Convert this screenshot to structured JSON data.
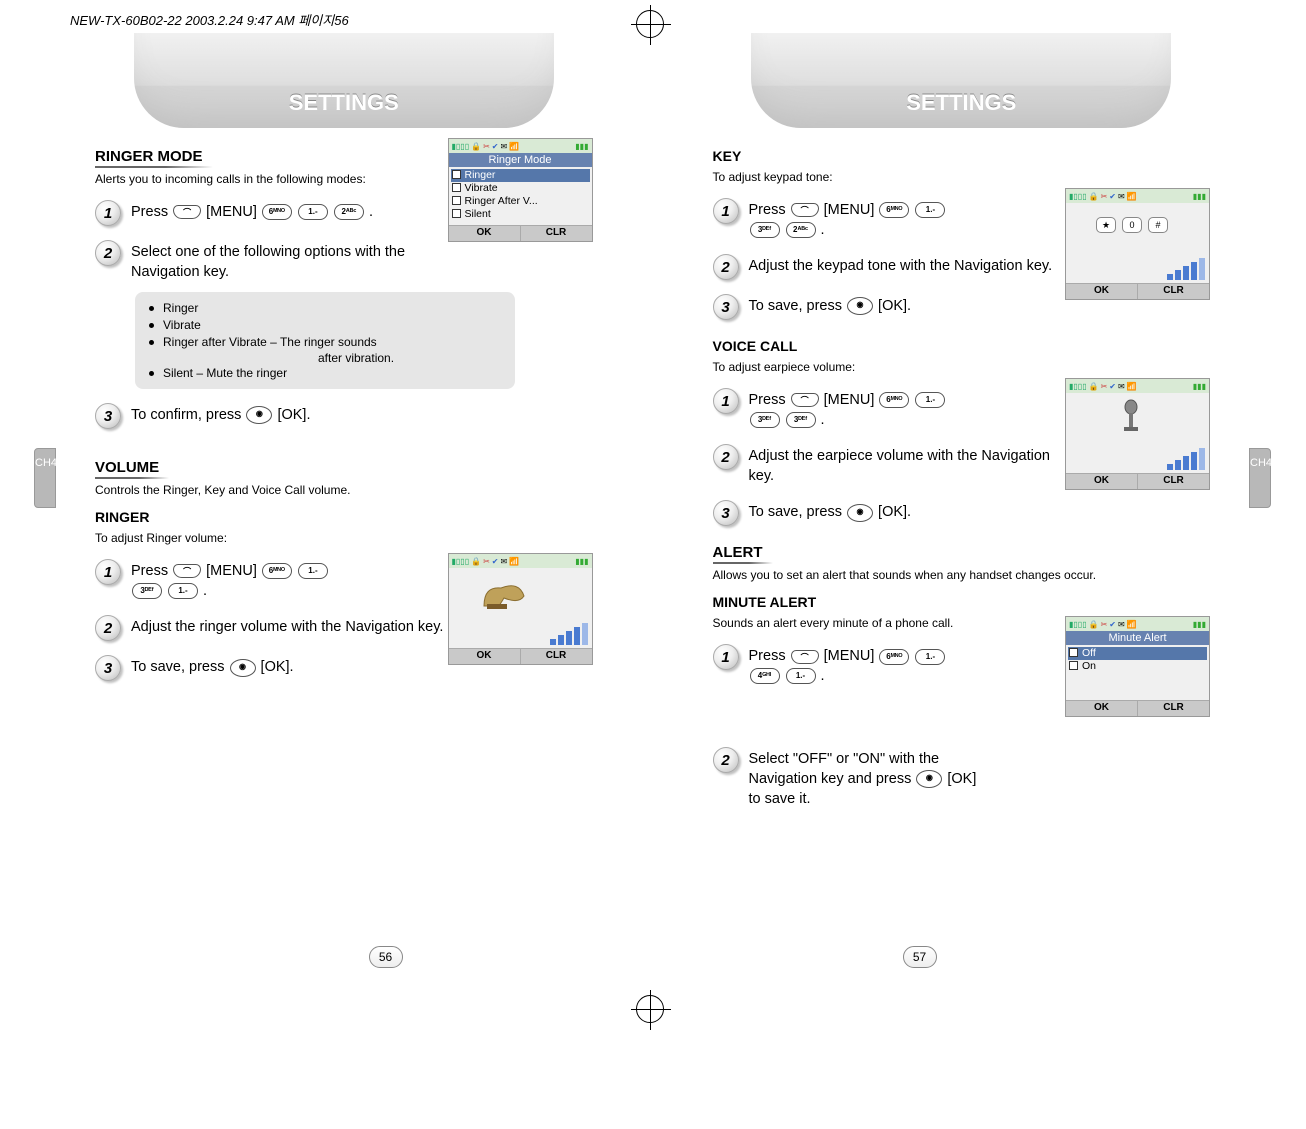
{
  "meta_header": "NEW-TX-60B02-22  2003.2.24 9:47 AM  페이지56",
  "left": {
    "banner": "SETTINGS",
    "side_tab": "CH4",
    "page_number": "56",
    "ringer_mode": {
      "heading": "RINGER MODE",
      "sub": "Alerts you to incoming calls in the following modes:",
      "step1": "Press          [MENU]                         .",
      "step1_menu": "[MENU]",
      "step2": "Select one of the following options with the Navigation key.",
      "options": {
        "a": "Ringer",
        "b": "Vibrate",
        "c": "Ringer after Vibrate – The ringer sounds",
        "c2": "after vibration.",
        "d": "Silent – Mute the ringer"
      },
      "step3": "To confirm, press           [OK].",
      "screen": {
        "title": "Ringer Mode",
        "opt1": "Ringer",
        "opt2": "Vibrate",
        "opt3": "Ringer After V...",
        "opt4": "Silent",
        "ok": "OK",
        "clr": "CLR"
      }
    },
    "volume": {
      "heading": "VOLUME",
      "sub": "Controls the Ringer, Key and Voice Call volume."
    },
    "ringer": {
      "heading": "RINGER",
      "sub": "To adjust Ringer volume:",
      "step1": "Press           [MENU]                   \n                         .",
      "step2": "Adjust the ringer volume with the Navigation key.",
      "step3": "To save, press           [OK].",
      "screen": {
        "ok": "OK",
        "clr": "CLR"
      }
    }
  },
  "right": {
    "banner": "SETTINGS",
    "side_tab": "CH4",
    "page_number": "57",
    "key": {
      "heading": "KEY",
      "sub": "To adjust keypad tone:",
      "step1": "Press           [MENU]                   \n                         .",
      "step2": "Adjust the keypad tone with the Navigation key.",
      "step3": "To save, press           [OK].",
      "screen": {
        "ok": "OK",
        "clr": "CLR"
      }
    },
    "voice": {
      "heading": "VOICE CALL",
      "sub": "To adjust earpiece volume:",
      "step1": "Press           [MENU]                   \n                         .",
      "step2": "Adjust the earpiece volume with the Navigation key.",
      "step3": "To save, press           [OK].",
      "screen": {
        "ok": "OK",
        "clr": "CLR"
      }
    },
    "alert": {
      "heading": "ALERT",
      "sub": "Allows you to set an alert that sounds when any handset changes occur."
    },
    "minute": {
      "heading": "MINUTE ALERT",
      "sub": "Sounds an alert every minute of a phone call.",
      "step1": "Press           [MENU]                   \n                     .",
      "step2": "Select \"OFF\" or \"ON\" with the Navigation key and press         [OK] to save it.",
      "screen": {
        "title": "Minute Alert",
        "opt1": "Off",
        "opt2": "On",
        "ok": "OK",
        "clr": "CLR"
      }
    }
  }
}
